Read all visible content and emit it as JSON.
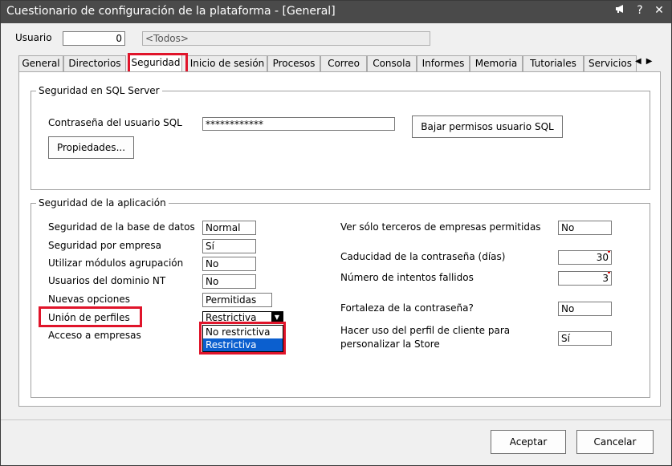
{
  "window": {
    "title": "Cuestionario de configuración de la plataforma - [General]",
    "icons": [
      "megaphone-icon",
      "help-icon",
      "close-icon"
    ],
    "help_glyph": "?",
    "close_glyph": "✕"
  },
  "usuario": {
    "label": "Usuario",
    "value": "0",
    "name": "<Todos>"
  },
  "tabs": [
    "General",
    "Directorios",
    "Seguridad",
    "Inicio de sesión",
    "Procesos",
    "Correo",
    "Consola",
    "Informes",
    "Memoria",
    "Tutoriales",
    "Servicios"
  ],
  "active_tab": "Seguridad",
  "sql_group": {
    "title": "Seguridad en SQL Server",
    "password_label": "Contraseña del usuario SQL",
    "password_value": "************",
    "lower_button": "Bajar permisos usuario SQL",
    "properties_button": "Propiedades..."
  },
  "app_group": {
    "title": "Seguridad de la aplicación",
    "left": [
      {
        "label": "Seguridad de la base de datos",
        "value": "Normal"
      },
      {
        "label": "Seguridad por empresa",
        "value": "Sí"
      },
      {
        "label": "Utilizar módulos agrupación",
        "value": "No"
      },
      {
        "label": "Usuarios del dominio NT",
        "value": "No"
      },
      {
        "label": "Nuevas opciones",
        "value": "Permitidas"
      },
      {
        "label": "Unión de perfiles",
        "value": "Restrictiva"
      },
      {
        "label": "Acceso a empresas",
        "value": ""
      }
    ],
    "dropdown_options": [
      "No restrictiva",
      "Restrictiva"
    ],
    "dropdown_selected": "Restrictiva",
    "right": [
      {
        "label": "Ver sólo terceros de empresas permitidas",
        "value": "No"
      },
      {
        "label": "Caducidad de la contraseña (días)",
        "value": "30"
      },
      {
        "label": "Número de intentos fallidos",
        "value": "3"
      },
      {
        "label": "Fortaleza de la contraseña?",
        "value": "No"
      },
      {
        "label": "Hacer uso del perfil de cliente para",
        "label2": "personalizar la Store",
        "value": "Sí"
      }
    ]
  },
  "footer": {
    "accept": "Aceptar",
    "cancel": "Cancelar"
  },
  "colors": {
    "titlebar": "#4a4a4a",
    "highlight": "#e0142a",
    "selection": "#0b5fcf"
  }
}
